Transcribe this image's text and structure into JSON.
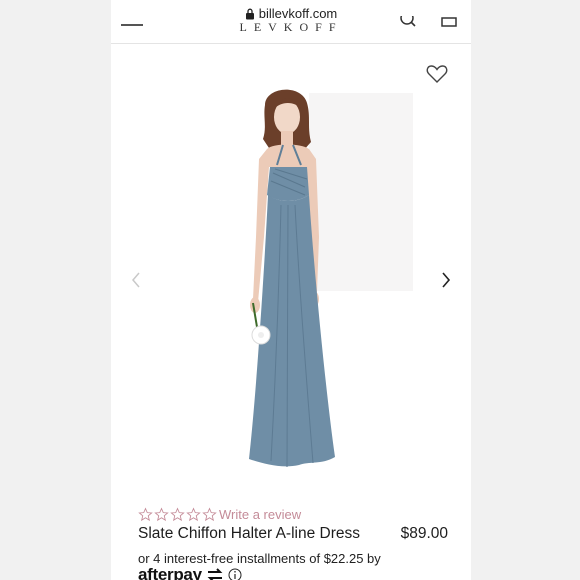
{
  "browser": {
    "url": "billevkoff.com"
  },
  "header": {
    "brand": "LEVKOFF"
  },
  "product": {
    "name": "Slate Chiffon Halter A-line Dress",
    "price": "$89.00",
    "rating_stars": 0,
    "review_link": "Write a review",
    "installment_text": "or 4 interest-free installments of $22.25 by",
    "payment_provider": "afterpay",
    "dress_color": "#6f8ea6"
  }
}
